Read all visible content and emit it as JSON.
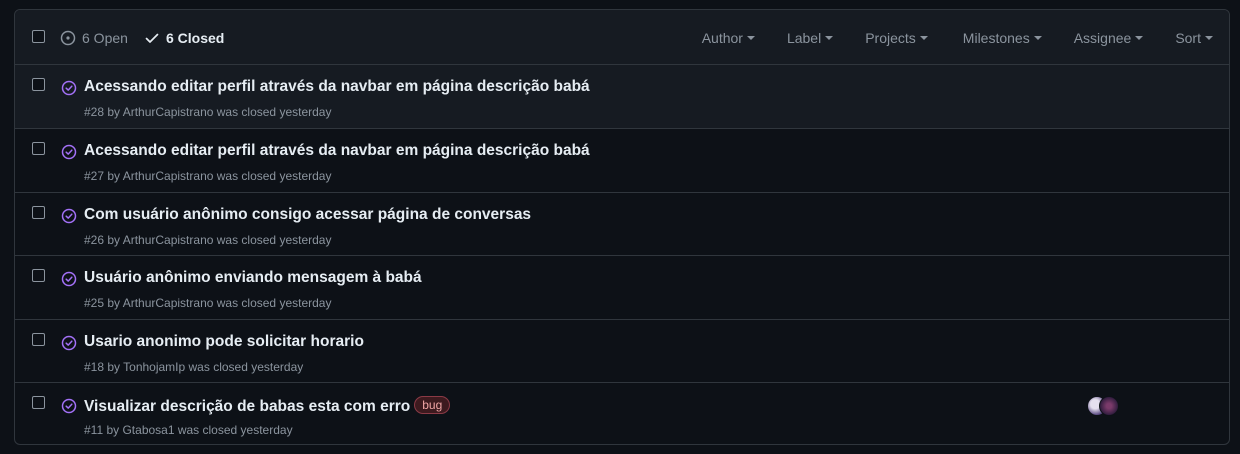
{
  "header": {
    "open_label": "6 Open",
    "closed_label": "6 Closed",
    "filters": [
      "Author",
      "Label",
      "Projects",
      "Milestones",
      "Assignee",
      "Sort"
    ]
  },
  "issues": [
    {
      "title": "Acessando editar perfil através da navbar em página descrição babá",
      "meta": "#28 by ArthurCapistrano was closed yesterday"
    },
    {
      "title": "Acessando editar perfil através da navbar em página descrição babá",
      "meta": "#27 by ArthurCapistrano was closed yesterday"
    },
    {
      "title": "Com usuário anônimo consigo acessar página de conversas",
      "meta": "#26 by ArthurCapistrano was closed yesterday"
    },
    {
      "title": "Usuário anônimo enviando mensagem à babá",
      "meta": "#25 by ArthurCapistrano was closed yesterday"
    },
    {
      "title": "Usario anonimo pode solicitar horario",
      "meta": "#18 by TonhojamIp was closed yesterday"
    },
    {
      "title": "Visualizar descrição de babas esta com erro",
      "label": "bug",
      "meta": "#11 by Gtabosa1 was closed yesterday"
    }
  ],
  "colors": {
    "closed_icon": "#a371f7",
    "label_bug_bg": "#3d1a1f",
    "label_bug_border": "#8b3a46",
    "label_bug_text": "#f0a5a5"
  },
  "icons": {
    "open_state": "issue-open-icon",
    "closed_state": "check-icon",
    "issue_status": "issue-closed-icon"
  }
}
